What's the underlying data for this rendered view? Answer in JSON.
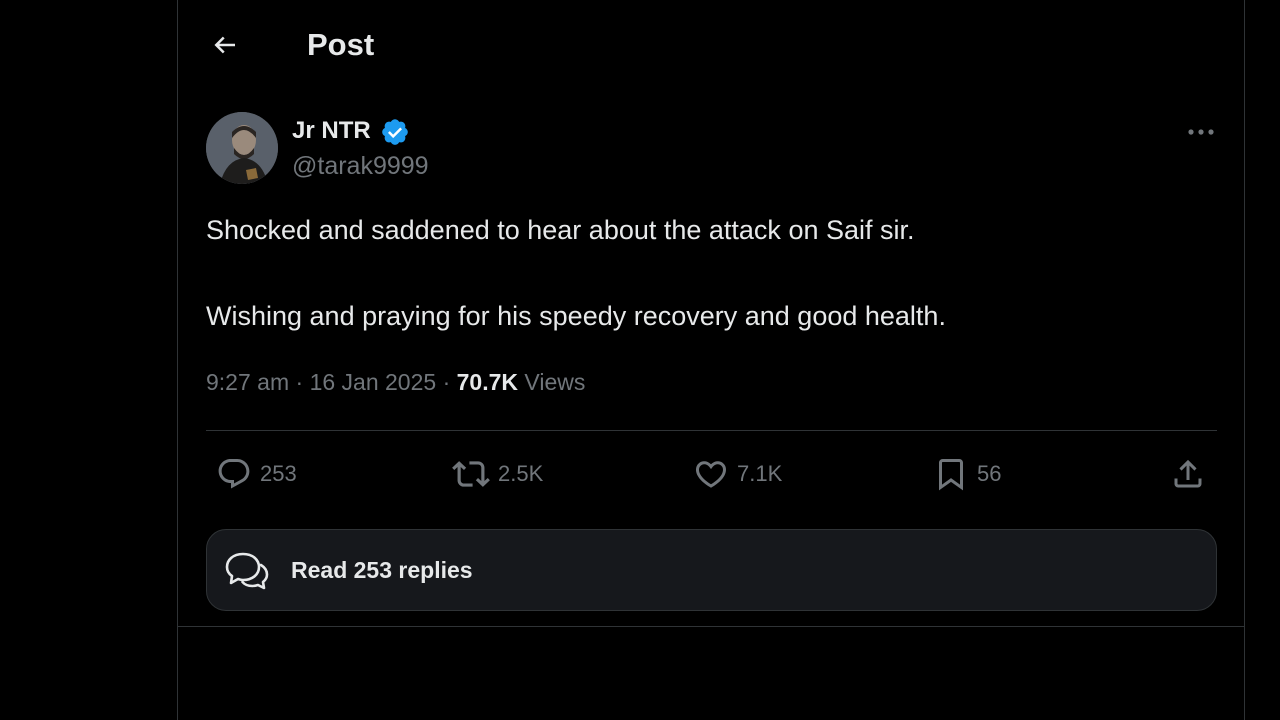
{
  "header": {
    "title": "Post"
  },
  "post": {
    "author": {
      "display_name": "Jr NTR",
      "handle": "@tarak9999",
      "verified": true
    },
    "text_lines": [
      "Shocked and saddened to hear about the attack on Saif sir.",
      "Wishing and praying for his speedy recovery and good health."
    ],
    "time": "9:27 am",
    "separator": "·",
    "date": "16 Jan 2025",
    "views_count": "70.7K",
    "views_label": "Views"
  },
  "actions": {
    "replies": "253",
    "reposts": "2.5K",
    "likes": "7.1K",
    "bookmarks": "56"
  },
  "read_replies_label": "Read 253 replies",
  "colors": {
    "background": "#000000",
    "text_primary": "#e7e9ea",
    "text_secondary": "#71767b",
    "border": "#2f3336",
    "verified_badge": "#1d9bf0",
    "card_background": "#16181c"
  },
  "icons": {
    "back": "arrow-left-icon",
    "verified": "verified-badge-icon",
    "more": "more-horizontal-icon",
    "reply": "reply-bubble-icon",
    "repost": "repost-icon",
    "like": "heart-icon",
    "bookmark": "bookmark-icon",
    "share": "share-icon",
    "read_replies": "conversation-bubbles-icon"
  }
}
